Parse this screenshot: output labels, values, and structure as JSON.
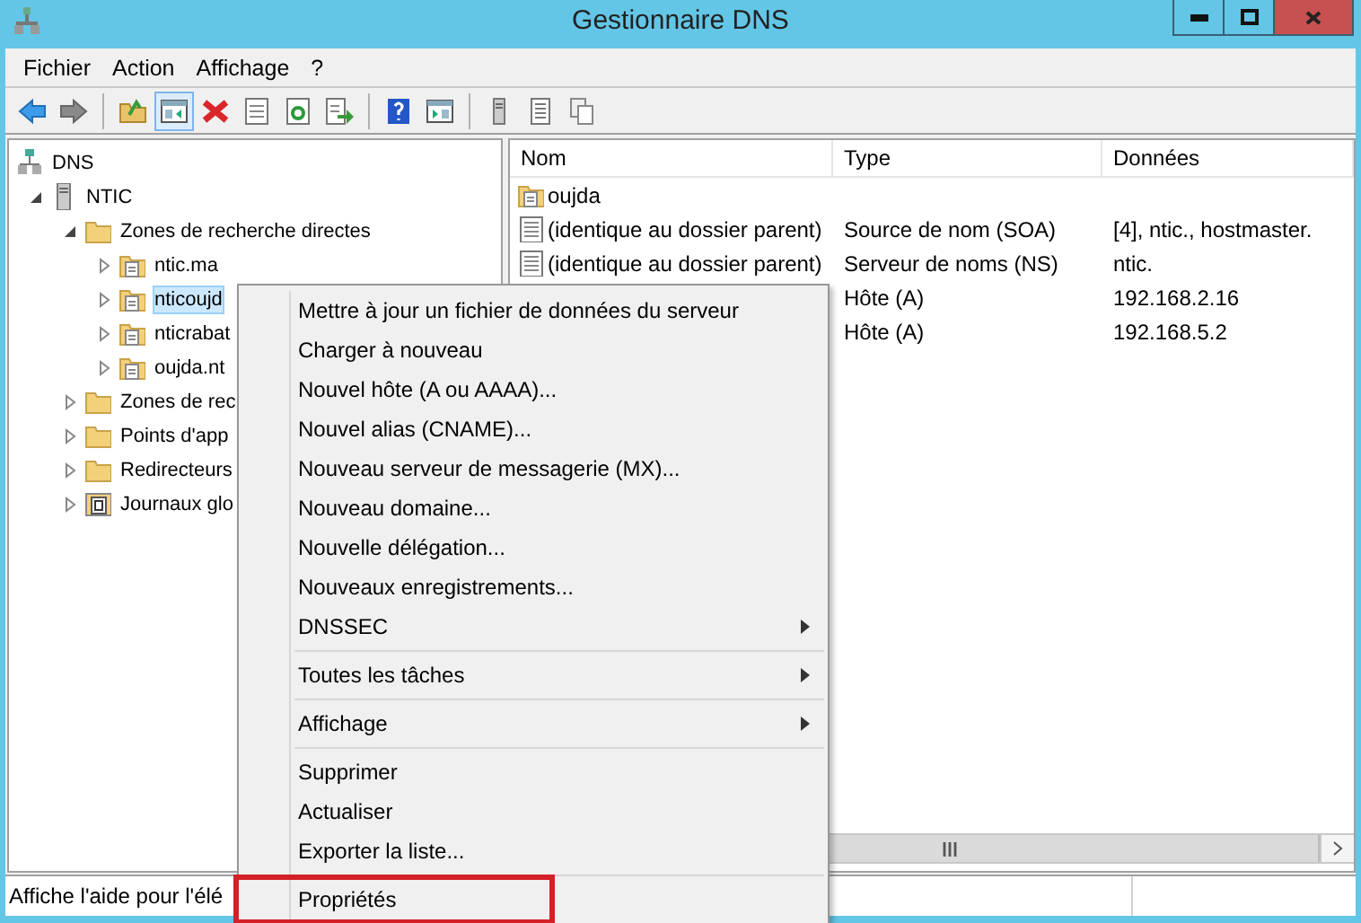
{
  "window": {
    "title": "Gestionnaire DNS"
  },
  "menu_bar": [
    "Fichier",
    "Action",
    "Affichage",
    "?"
  ],
  "toolbar": [
    {
      "kind": "back",
      "selected": false
    },
    {
      "kind": "forward",
      "selected": false
    },
    {
      "kind": "separator"
    },
    {
      "kind": "up-folder",
      "selected": false
    },
    {
      "kind": "show-pane",
      "selected": true
    },
    {
      "kind": "delete",
      "selected": false
    },
    {
      "kind": "properties",
      "selected": false
    },
    {
      "kind": "refresh",
      "selected": false
    },
    {
      "kind": "export",
      "selected": false
    },
    {
      "kind": "separator"
    },
    {
      "kind": "help",
      "selected": false
    },
    {
      "kind": "action-pane",
      "selected": false
    },
    {
      "kind": "separator"
    },
    {
      "kind": "server",
      "selected": false
    },
    {
      "kind": "list",
      "selected": false
    },
    {
      "kind": "copy",
      "selected": false
    }
  ],
  "tree": [
    {
      "label": "DNS",
      "kind": "dns",
      "selected": false,
      "children": [
        {
          "label": "NTIC",
          "kind": "server",
          "expanded": true,
          "selected": false,
          "children": [
            {
              "label": "Zones de recherche directes",
              "kind": "folder",
              "expanded": true,
              "selected": false,
              "children": [
                {
                  "label": "ntic.ma",
                  "kind": "zone",
                  "expanded": false,
                  "selected": false
                },
                {
                  "label": "nticoujd",
                  "kind": "zone",
                  "expanded": false,
                  "selected": true
                },
                {
                  "label": "nticrabat",
                  "kind": "zone",
                  "expanded": false,
                  "selected": false
                },
                {
                  "label": "oujda.nt",
                  "kind": "zone",
                  "expanded": false,
                  "selected": false
                }
              ]
            },
            {
              "label": "Zones de rec",
              "kind": "folder",
              "expanded": false,
              "selected": false
            },
            {
              "label": "Points d'app",
              "kind": "folder",
              "expanded": false,
              "selected": false
            },
            {
              "label": "Redirecteurs",
              "kind": "folder",
              "expanded": false,
              "selected": false
            },
            {
              "label": "Journaux glo",
              "kind": "log",
              "expanded": false,
              "selected": false
            }
          ]
        }
      ]
    }
  ],
  "list": {
    "columns": [
      "Nom",
      "Type",
      "Données"
    ],
    "rows": [
      {
        "kind": "zone",
        "name": "oujda"
      },
      {
        "kind": "record",
        "name": "(identique au dossier parent)",
        "type": "Source de nom (SOA)",
        "data": "[4], ntic., hostmaster."
      },
      {
        "kind": "record",
        "name": "(identique au dossier parent)",
        "type": "Serveur de noms (NS)",
        "data": "ntic."
      },
      {
        "type": "Hôte (A)",
        "data": "192.168.2.16"
      },
      {
        "type": "Hôte (A)",
        "data": "192.168.5.2"
      }
    ]
  },
  "context_menu": {
    "groups": [
      [
        {
          "label": "Mettre à jour un fichier de données du serveur",
          "submenu": false,
          "highlighted": false
        },
        {
          "label": "Charger à nouveau",
          "submenu": false,
          "highlighted": false
        },
        {
          "label": "Nouvel hôte (A ou AAAA)...",
          "submenu": false,
          "highlighted": false
        },
        {
          "label": "Nouvel alias (CNAME)...",
          "submenu": false,
          "highlighted": false
        },
        {
          "label": "Nouveau serveur de messagerie (MX)...",
          "submenu": false,
          "highlighted": false
        },
        {
          "label": "Nouveau domaine...",
          "submenu": false,
          "highlighted": false
        },
        {
          "label": "Nouvelle délégation...",
          "submenu": false,
          "highlighted": false
        },
        {
          "label": "Nouveaux enregistrements...",
          "submenu": false,
          "highlighted": false
        },
        {
          "label": "DNSSEC",
          "submenu": true,
          "highlighted": false
        }
      ],
      [
        {
          "label": "Toutes les tâches",
          "submenu": true,
          "highlighted": false
        }
      ],
      [
        {
          "label": "Affichage",
          "submenu": true,
          "highlighted": false
        }
      ],
      [
        {
          "label": "Supprimer",
          "submenu": false,
          "highlighted": false
        },
        {
          "label": "Actualiser",
          "submenu": false,
          "highlighted": false
        },
        {
          "label": "Exporter la liste...",
          "submenu": false,
          "highlighted": false
        }
      ],
      [
        {
          "label": "Propriétés",
          "submenu": false,
          "highlighted": true
        }
      ]
    ]
  },
  "status_bar": {
    "text": "Affiche l'aide pour l'élé"
  }
}
